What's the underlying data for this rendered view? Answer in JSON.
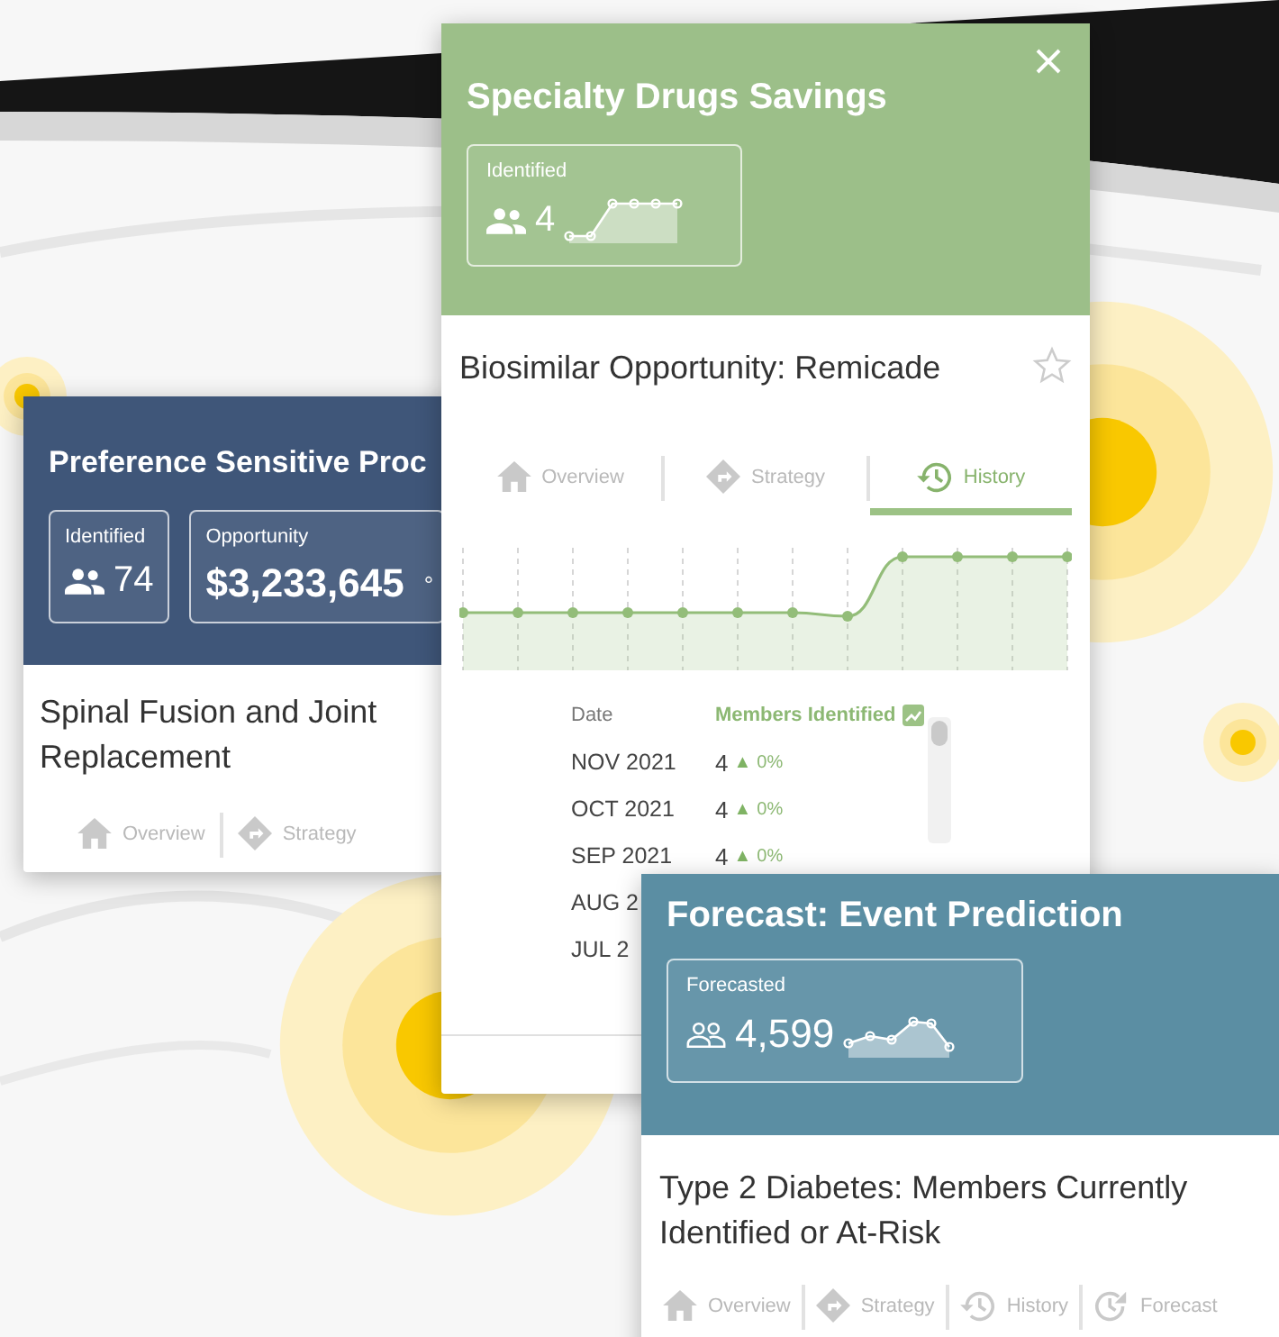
{
  "cards": [
    {
      "color": "#3f5679",
      "header_title": "Preference Sensitive Proc",
      "stats": [
        {
          "kind": "count",
          "label": "Identified",
          "value": "74"
        },
        {
          "kind": "amount",
          "label": "Opportunity",
          "value": "$3,233,645",
          "suffix": "°"
        }
      ],
      "title": "Spinal Fusion and Joint Replacement",
      "tabs": [
        {
          "kind": "overview",
          "label": "Overview",
          "selected": false
        },
        {
          "kind": "strategy",
          "label": "Strategy",
          "selected": false
        }
      ]
    },
    {
      "color": "#9cbf89",
      "header_title": "Specialty Drugs Savings",
      "closable": true,
      "stats": [
        {
          "kind": "count-rising",
          "label": "Identified",
          "value": "4"
        }
      ],
      "title": "Biosimilar Opportunity: Remicade",
      "starred": false,
      "tabs": [
        {
          "kind": "overview",
          "label": "Overview",
          "selected": false
        },
        {
          "kind": "strategy",
          "label": "Strategy",
          "selected": false
        },
        {
          "kind": "history",
          "label": "History",
          "selected": true
        }
      ],
      "history": {
        "columns": [
          "Date",
          "Members Identified"
        ],
        "rows": [
          {
            "date": "NOV 2021",
            "count": "4",
            "trend": "▲",
            "change": "0%"
          },
          {
            "date": "OCT 2021",
            "count": "4",
            "trend": "▲",
            "change": "0%"
          },
          {
            "date": "SEP 2021",
            "count": "4",
            "trend": "▲",
            "change": "0%"
          },
          {
            "date": "AUG 2"
          },
          {
            "date": "JUL 2"
          }
        ]
      }
    },
    {
      "color": "#5b8ea3",
      "header_title": "Forecast: Event Prediction",
      "stats": [
        {
          "kind": "forecast",
          "label": "Forecasted",
          "value": "4,599"
        }
      ],
      "title": "Type 2 Diabetes: Members Currently Identified or At-Risk",
      "tabs": [
        {
          "kind": "overview",
          "label": "Overview",
          "selected": false
        },
        {
          "kind": "strategy",
          "label": "Strategy",
          "selected": false
        },
        {
          "kind": "history",
          "label": "History",
          "selected": false
        },
        {
          "kind": "forecast",
          "label": "Forecast",
          "selected": false
        }
      ]
    }
  ]
}
